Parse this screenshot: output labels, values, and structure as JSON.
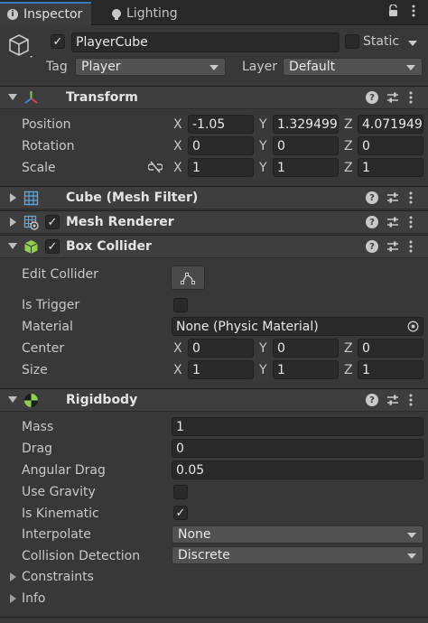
{
  "tabs": [
    {
      "label": "Inspector",
      "icon": "info-icon"
    },
    {
      "label": "Lighting",
      "icon": "bulb-icon"
    }
  ],
  "header": {
    "object_name": "PlayerCube",
    "active": true,
    "static_label": "Static",
    "static": false,
    "tag_label": "Tag",
    "tag_value": "Player",
    "layer_label": "Layer",
    "layer_value": "Default"
  },
  "help_glyph": "?",
  "transform": {
    "title": "Transform",
    "rows": [
      {
        "label": "Position",
        "x": "-1.05",
        "y": "1.329499",
        "z": "4.071949"
      },
      {
        "label": "Rotation",
        "x": "0",
        "y": "0",
        "z": "0"
      },
      {
        "label": "Scale",
        "x": "1",
        "y": "1",
        "z": "1"
      }
    ]
  },
  "axes": {
    "x": "X",
    "y": "Y",
    "z": "Z"
  },
  "mesh_filter": {
    "title": "Cube (Mesh Filter)"
  },
  "mesh_renderer": {
    "title": "Mesh Renderer",
    "enabled": true
  },
  "box_collider": {
    "title": "Box Collider",
    "enabled": true,
    "edit_collider_label": "Edit Collider",
    "is_trigger_label": "Is Trigger",
    "is_trigger": false,
    "material_label": "Material",
    "material_value": "None (Physic Material)",
    "center_label": "Center",
    "center": {
      "x": "0",
      "y": "0",
      "z": "0"
    },
    "size_label": "Size",
    "size": {
      "x": "1",
      "y": "1",
      "z": "1"
    }
  },
  "rigidbody": {
    "title": "Rigidbody",
    "mass_label": "Mass",
    "mass": "1",
    "drag_label": "Drag",
    "drag": "0",
    "angular_drag_label": "Angular Drag",
    "angular_drag": "0.05",
    "use_gravity_label": "Use Gravity",
    "use_gravity": false,
    "is_kinematic_label": "Is Kinematic",
    "is_kinematic": true,
    "interpolate_label": "Interpolate",
    "interpolate": "None",
    "collision_label": "Collision Detection",
    "collision": "Discrete",
    "constraints_label": "Constraints",
    "info_label": "Info"
  },
  "check_glyph": "✓",
  "colors": {
    "accent": "#3a79bb",
    "panel": "#383838",
    "header": "#3e3e3e",
    "field": "#2a2a2a"
  }
}
